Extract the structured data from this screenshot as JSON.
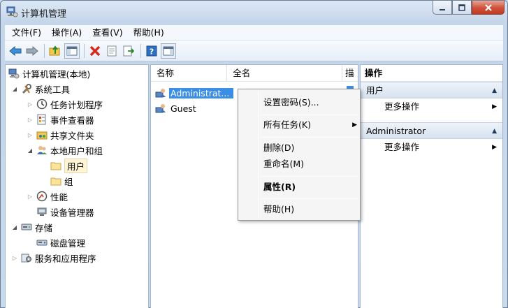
{
  "window": {
    "title": "计算机管理"
  },
  "menu": [
    "文件(F)",
    "操作(A)",
    "查看(V)",
    "帮助(H)"
  ],
  "tree": {
    "root": "计算机管理(本地)",
    "system_tools": "系统工具",
    "task_scheduler": "任务计划程序",
    "event_viewer": "事件查看器",
    "shared_folders": "共享文件夹",
    "local_users_groups": "本地用户和组",
    "users": "用户",
    "groups": "组",
    "performance": "性能",
    "device_manager": "设备管理器",
    "storage": "存储",
    "disk_management": "磁盘管理",
    "services_apps": "服务和应用程序"
  },
  "list": {
    "columns": [
      "名称",
      "全名",
      "描"
    ],
    "rows": [
      "Administrat...",
      "Guest"
    ]
  },
  "actions": {
    "header": "操作",
    "group1": "用户",
    "group1_more": "更多操作",
    "group2": "Administrator",
    "group2_more": "更多操作"
  },
  "context_menu": {
    "set_password": "设置密码(S)...",
    "all_tasks": "所有任务(K)",
    "delete": "删除(D)",
    "rename": "重命名(M)",
    "properties": "属性(R)",
    "help": "帮助(H)"
  },
  "colors": {
    "selection": "#3a8ee6",
    "frame": "#c9d9ec",
    "close": "#c23a22"
  }
}
